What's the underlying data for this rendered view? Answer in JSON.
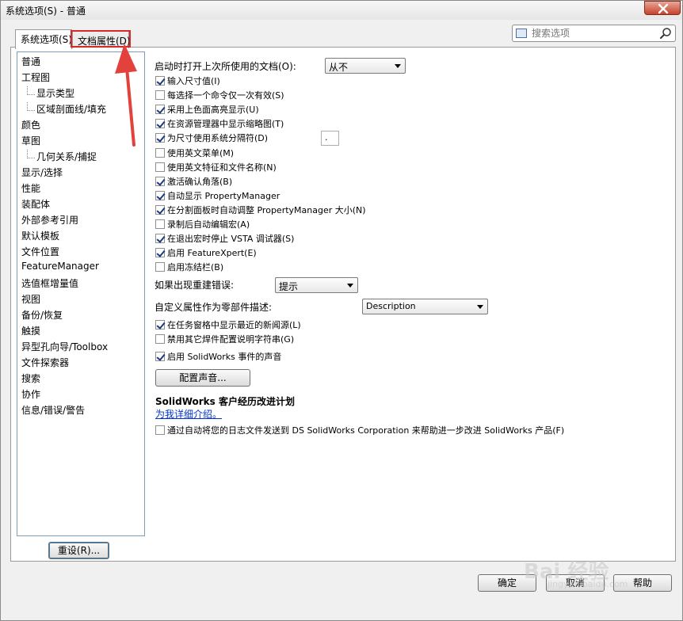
{
  "window": {
    "title": "系统选项(S) - 普通"
  },
  "tabs": [
    {
      "label": "系统选项(S)"
    },
    {
      "label": "文档属性(D)"
    }
  ],
  "search": {
    "placeholder": "搜索选项"
  },
  "tree": {
    "items": [
      {
        "label": "普通"
      },
      {
        "label": "工程图"
      },
      {
        "label": "显示类型"
      },
      {
        "label": "区域剖面线/填充"
      },
      {
        "label": "颜色"
      },
      {
        "label": "草图"
      },
      {
        "label": "几何关系/捕捉"
      },
      {
        "label": "显示/选择"
      },
      {
        "label": "性能"
      },
      {
        "label": "装配体"
      },
      {
        "label": "外部参考引用"
      },
      {
        "label": "默认模板"
      },
      {
        "label": "文件位置"
      },
      {
        "label": "FeatureManager"
      },
      {
        "label": "选值框增量值"
      },
      {
        "label": "视图"
      },
      {
        "label": "备份/恢复"
      },
      {
        "label": "触摸"
      },
      {
        "label": "异型孔向导/Toolbox"
      },
      {
        "label": "文件探索器"
      },
      {
        "label": "搜索"
      },
      {
        "label": "协作"
      },
      {
        "label": "信息/错误/警告"
      }
    ]
  },
  "main": {
    "open_last_docs_label": "启动时打开上次所使用的文档(O):",
    "open_last_docs_value": "从不",
    "checkboxes": [
      {
        "label": "输入尺寸值(I)",
        "checked": true
      },
      {
        "label": "每选择一个命令仅一次有效(S)",
        "checked": false
      },
      {
        "label": "采用上色面高亮显示(U)",
        "checked": true
      },
      {
        "label": "在资源管理器中显示缩略图(T)",
        "checked": true
      },
      {
        "label": "为尺寸使用系统分隔符(D)",
        "checked": true
      },
      {
        "label": "使用英文菜单(M)",
        "checked": false
      },
      {
        "label": "使用英文特征和文件名称(N)",
        "checked": false
      },
      {
        "label": "激活确认角落(B)",
        "checked": true
      },
      {
        "label": "自动显示 PropertyManager",
        "checked": true
      },
      {
        "label": "在分割面板时自动调整 PropertyManager 大小(N)",
        "checked": true
      },
      {
        "label": "录制后自动编辑宏(A)",
        "checked": false
      },
      {
        "label": "在退出宏时停止 VSTA 调试器(S)",
        "checked": true
      },
      {
        "label": "启用 FeatureXpert(E)",
        "checked": true
      },
      {
        "label": "启用冻结栏(B)",
        "checked": false
      }
    ],
    "separator_value": ".",
    "rebuild_error_label": "如果出现重建错误:",
    "rebuild_error_value": "提示",
    "custom_prop_label": "自定义属性作为零部件描述:",
    "custom_prop_value": "Description",
    "checkboxes2": [
      {
        "label": "在任务窗格中显示最近的新闻源(L)",
        "checked": true
      },
      {
        "label": "禁用其它焊件配置说明字符串(G)",
        "checked": false
      },
      {
        "label": "启用 SolidWorks 事件的声音",
        "checked": true
      }
    ],
    "config_sound_button": "配置声音...",
    "ceip_title": "SolidWorks 客户经历改进计划",
    "ceip_link": "为我详细介绍。",
    "ceip_checkbox": {
      "label": "通过自动将您的日志文件发送到 DS SolidWorks Corporation 来帮助进一步改进 SolidWorks 产品(F)",
      "checked": false
    }
  },
  "footer": {
    "reset_label": "重设(R)...",
    "ok_label": "确定",
    "cancel_label": "取消",
    "help_label": "帮助"
  },
  "watermark": {
    "text": "Bai  经验",
    "sub": "jingyan.baidu.com"
  }
}
